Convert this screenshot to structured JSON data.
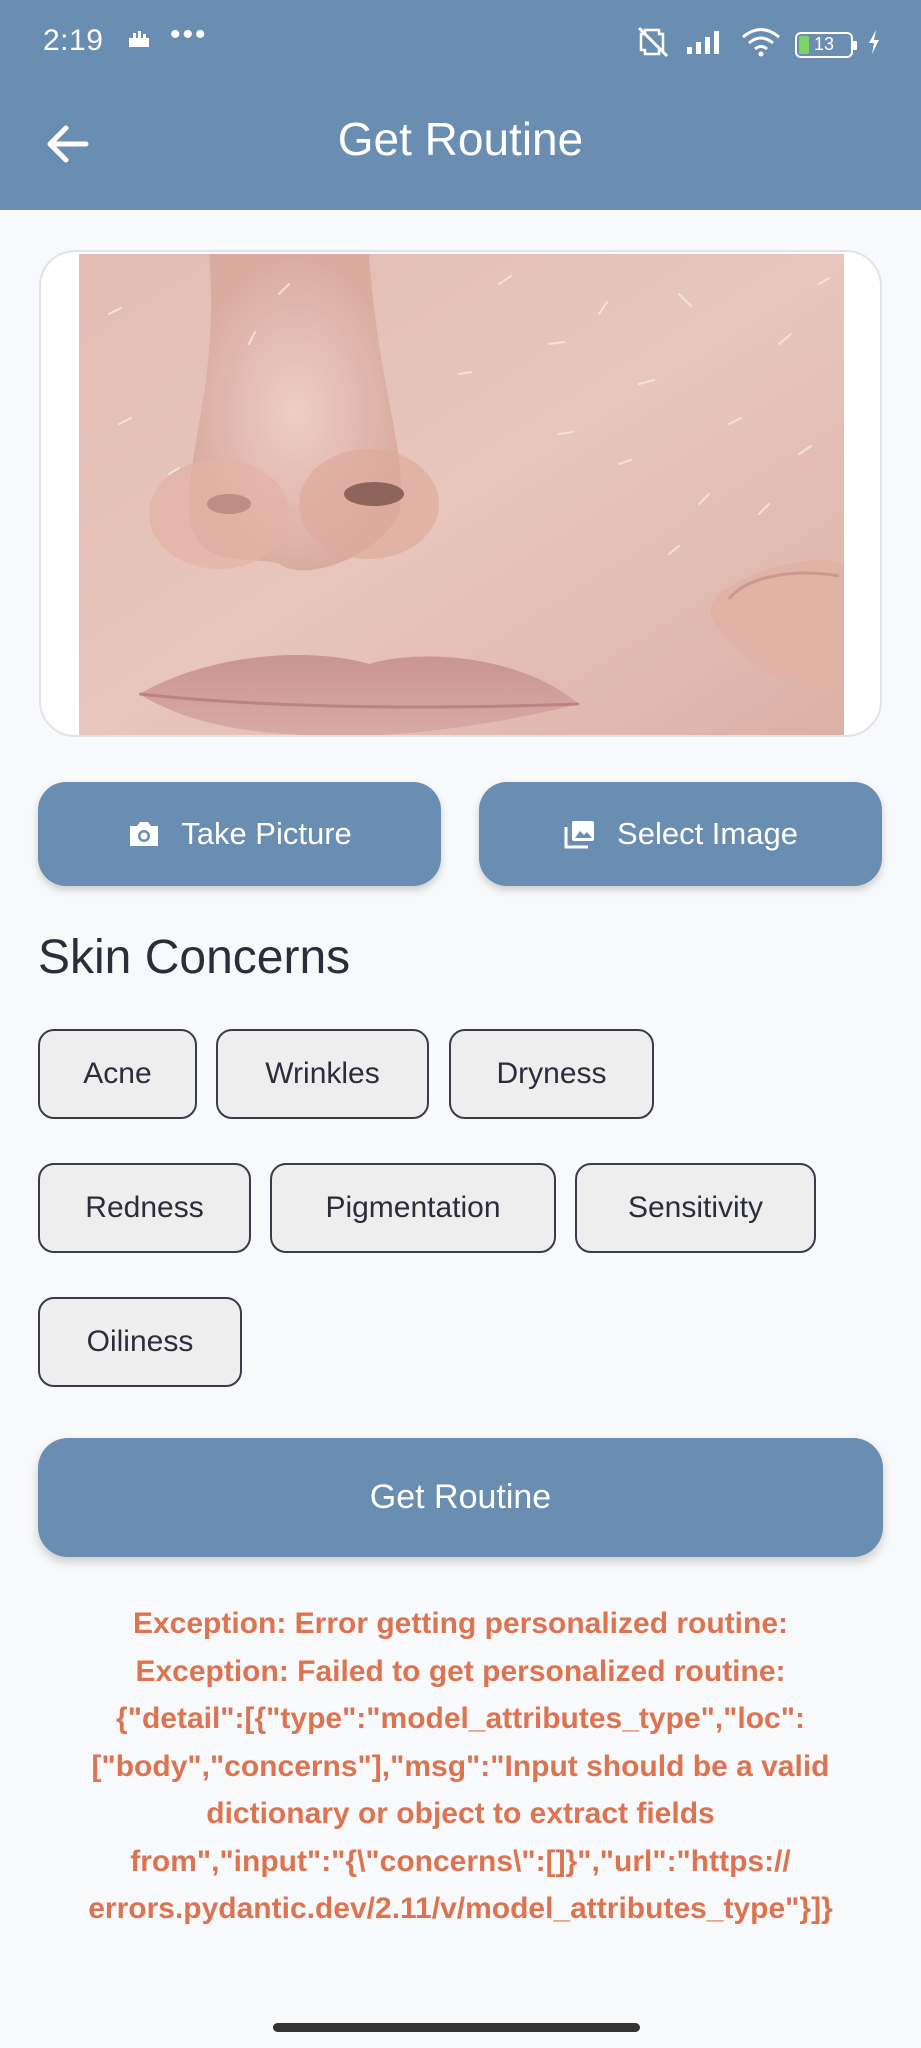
{
  "status_bar": {
    "time": "2:19",
    "more": "•••",
    "battery": "13"
  },
  "app_bar": {
    "title": "Get Routine"
  },
  "image_preview": {
    "description": "close-up photo of face with dry flaky skin"
  },
  "buttons": {
    "take_picture": "Take Picture",
    "select_image": "Select Image",
    "get_routine": "Get Routine"
  },
  "skin_concerns": {
    "title": "Skin Concerns",
    "chips": [
      "Acne",
      "Wrinkles",
      "Dryness",
      "Redness",
      "Pigmentation",
      "Sensitivity",
      "Oiliness"
    ]
  },
  "error": {
    "lines": [
      "Exception: Error getting personalized routine:",
      "Exception: Failed to get personalized routine:",
      "{\"detail\":[{\"type\":\"model_attributes_type\",\"loc\":",
      "[\"body\",\"concerns\"],\"msg\":\"Input should be a valid",
      "dictionary or object to extract fields",
      "from\",\"input\":\"{\\\"concerns\\\":[]}\",\"url\":\"https://",
      "errors.pydantic.dev/2.11/v/model_attributes_type\"}]}"
    ]
  },
  "colors": {
    "primary": "#6a8db2",
    "error": "#dc7351",
    "background": "#f8f9fb"
  }
}
